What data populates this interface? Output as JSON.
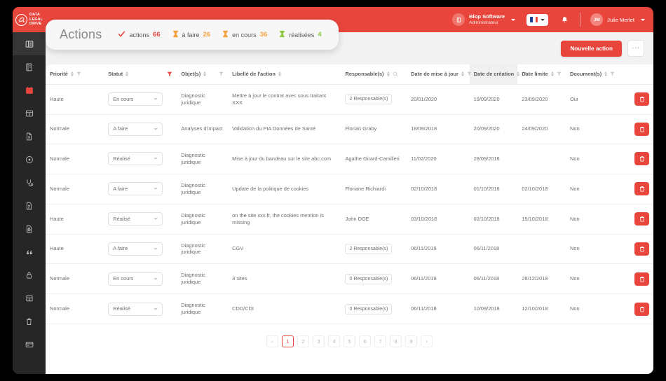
{
  "brand": {
    "logo_mark": "dld",
    "logo_lines": [
      "DATA",
      "LEGAL",
      "DRIVE"
    ],
    "accent_color": "#e8463c"
  },
  "sidebar": {
    "items": [
      {
        "name": "dashboard-icon",
        "label": "Tableau de bord",
        "state": "active"
      },
      {
        "name": "register-icon",
        "label": "Registre",
        "state": "default"
      },
      {
        "name": "calendar-icon",
        "label": "Actions",
        "state": "red"
      },
      {
        "name": "grid-icon",
        "label": "Cartographie",
        "state": "default"
      },
      {
        "name": "document-icon",
        "label": "Documents",
        "state": "default"
      },
      {
        "name": "target-icon",
        "label": "Pilotage",
        "state": "default"
      },
      {
        "name": "stethoscope-icon",
        "label": "Diagnostic",
        "state": "default"
      },
      {
        "name": "file-text-icon",
        "label": "Analyses",
        "state": "default"
      },
      {
        "name": "file-lock-icon",
        "label": "Sous-traitants",
        "state": "default"
      },
      {
        "name": "quote-icon",
        "label": "Mentions",
        "state": "default"
      },
      {
        "name": "lock-icon",
        "label": "Sécurité",
        "state": "default"
      },
      {
        "name": "book-icon",
        "label": "Bibliothèque",
        "state": "default"
      },
      {
        "name": "trash-icon",
        "label": "Corbeille",
        "state": "default"
      },
      {
        "name": "card-icon",
        "label": "Abonnement",
        "state": "default"
      }
    ]
  },
  "topbar": {
    "org_name": "Blop Software",
    "org_role": "Administrateur",
    "language": "fr",
    "user_initials": "JM",
    "user_name": "Julie Merlet"
  },
  "toolbar": {
    "new_action_label": "Nouvelle action",
    "more_label": "···"
  },
  "header_card": {
    "title": "Actions",
    "stats": [
      {
        "icon": "check-icon",
        "label": "actions",
        "value": "66",
        "color": "#e8463c"
      },
      {
        "icon": "hourglass-icon",
        "label": "à faire",
        "value": "26",
        "color": "#f4a03c"
      },
      {
        "icon": "hourglass-icon",
        "label": "en cours",
        "value": "36",
        "color": "#f4a03c"
      },
      {
        "icon": "hourglass-icon",
        "label": "réalisées",
        "value": "4",
        "color": "#8cc63f"
      }
    ]
  },
  "table": {
    "columns": [
      {
        "key": "priorite",
        "label": "Priorité",
        "sortable": true,
        "filter": "grey",
        "highlight": false
      },
      {
        "key": "statut",
        "label": "Statut",
        "sortable": true,
        "filter": "red",
        "highlight": false
      },
      {
        "key": "objets",
        "label": "Objet(s)",
        "sortable": true,
        "filter": "grey",
        "highlight": false
      },
      {
        "key": "libelle",
        "label": "Libellé de l'action",
        "sortable": true,
        "filter": "none",
        "highlight": false
      },
      {
        "key": "responsables",
        "label": "Responsable(s)",
        "sortable": true,
        "filter": "search",
        "highlight": false
      },
      {
        "key": "maj",
        "label": "Date de mise à jour",
        "sortable": true,
        "filter": "grey",
        "highlight": false
      },
      {
        "key": "creation",
        "label": "Date de création",
        "sortable": true,
        "filter": "grey",
        "highlight": true
      },
      {
        "key": "limite",
        "label": "Date limite",
        "sortable": true,
        "filter": "grey",
        "highlight": false
      },
      {
        "key": "documents",
        "label": "Document(s)",
        "sortable": true,
        "filter": "grey",
        "highlight": false
      },
      {
        "key": "actions",
        "label": "",
        "sortable": false,
        "filter": "none",
        "highlight": false
      }
    ],
    "rows": [
      {
        "priorite": "Haute",
        "statut": "En cours",
        "objets": "Diagnostic juridique",
        "libelle": "Mettre à jour le contrat avec sous traitant XXX",
        "responsables": "2 Responsable(s)",
        "responsables_type": "pill",
        "maj": "20/01/2020",
        "creation": "19/09/2020",
        "limite": "23/09/2020",
        "documents": "Oui"
      },
      {
        "priorite": "Normale",
        "statut": "A faire",
        "objets": "Analyses d'impact",
        "libelle": "Validation du PIA Données de Santé",
        "responsables": "Florian Graby",
        "responsables_type": "text",
        "maj": "18/09/2018",
        "creation": "20/09/2020",
        "limite": "24/09/2020",
        "documents": "Non"
      },
      {
        "priorite": "Normale",
        "statut": "Réalisé",
        "objets": "Diagnostic juridique",
        "libelle": "Mise à jour du bandeau sur le site abc.com",
        "responsables": "Agathe Girard-Camilleri",
        "responsables_type": "text",
        "maj": "11/02/2020",
        "creation": "28/09/2018",
        "limite": "",
        "documents": "Non"
      },
      {
        "priorite": "Normale",
        "statut": "A faire",
        "objets": "Diagnostic juridique",
        "libelle": "Update de la politique de cookies",
        "responsables": "Floriane Richiardi",
        "responsables_type": "text",
        "maj": "02/10/2018",
        "creation": "01/10/2018",
        "limite": "02/10/2018",
        "documents": "Non"
      },
      {
        "priorite": "Haute",
        "statut": "Réalisé",
        "objets": "Diagnostic juridique",
        "libelle": "on the site xxx.fr, the cookies mention is missing",
        "responsables": "John DOE",
        "responsables_type": "text",
        "maj": "03/10/2018",
        "creation": "02/10/2018",
        "limite": "15/10/2018",
        "documents": "Non"
      },
      {
        "priorite": "Haute",
        "statut": "A faire",
        "objets": "Diagnostic juridique",
        "libelle": "CGV",
        "responsables": "2 Responsable(s)",
        "responsables_type": "pill",
        "maj": "06/11/2018",
        "creation": "06/11/2018",
        "limite": "",
        "documents": "Non"
      },
      {
        "priorite": "Normale",
        "statut": "En cours",
        "objets": "Diagnostic juridique",
        "libelle": "3 sites",
        "responsables": "0 Responsable(s)",
        "responsables_type": "pill",
        "maj": "06/11/2018",
        "creation": "06/11/2018",
        "limite": "28/12/2018",
        "documents": "Non"
      },
      {
        "priorite": "Normale",
        "statut": "Réalisé",
        "objets": "Diagnostic juridique",
        "libelle": "CDD/CDI",
        "responsables": "0 Responsable(s)",
        "responsables_type": "pill",
        "maj": "06/11/2018",
        "creation": "10/09/2018",
        "limite": "12/10/2018",
        "documents": "Non"
      }
    ]
  },
  "pagination": {
    "prev": "‹",
    "next": "›",
    "pages": [
      "1",
      "2",
      "3",
      "4",
      "5",
      "6",
      "7",
      "8",
      "9"
    ],
    "current": "1"
  }
}
